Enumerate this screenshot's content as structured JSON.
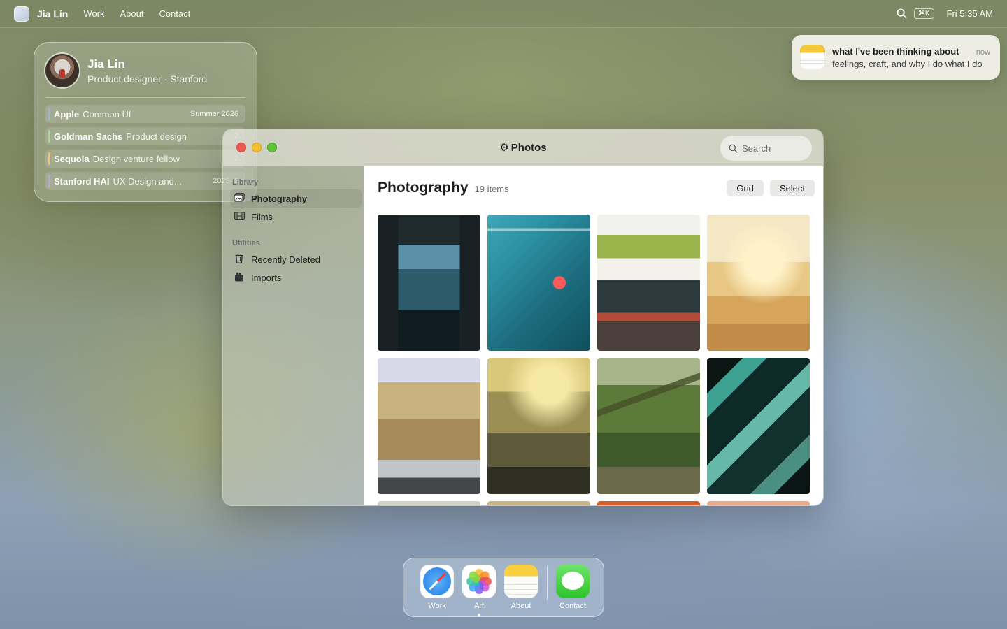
{
  "menubar": {
    "brand": "Jia Lin",
    "items": [
      "Work",
      "About",
      "Contact"
    ],
    "shortcut": "⌘K",
    "clock": "Fri 5:35 AM"
  },
  "profile": {
    "name": "Jia Lin",
    "role": "Product designer · Stanford",
    "experience": [
      {
        "company": "Apple",
        "role": "Common UI",
        "date": "Summer 2026",
        "color": "#9ab0e8"
      },
      {
        "company": "Goldman Sachs",
        "role": "Product design",
        "date": "2",
        "color": "#a8d8a0"
      },
      {
        "company": "Sequoia",
        "role": "Design venture fellow",
        "date": "2",
        "color": "#f2c46a"
      },
      {
        "company": "Stanford HAI",
        "role": "UX Design and...",
        "date": "2025–2",
        "color": "#b9a3e6"
      }
    ]
  },
  "notification": {
    "title": "what I've been thinking about",
    "time": "now",
    "text": "feelings, craft, and why I do what I do"
  },
  "window": {
    "title": "Photos",
    "search_placeholder": "Search",
    "sidebar": {
      "library_label": "Library",
      "library_items": [
        {
          "label": "Photography",
          "icon": "photo-stack-icon"
        },
        {
          "label": "Films",
          "icon": "film-icon"
        }
      ],
      "utilities_label": "Utilities",
      "utility_items": [
        {
          "label": "Recently Deleted",
          "icon": "trash-icon"
        },
        {
          "label": "Imports",
          "icon": "import-icon"
        }
      ]
    },
    "main": {
      "title": "Photography",
      "count": "19 items",
      "grid_button": "Grid",
      "select_button": "Select"
    }
  },
  "dock": [
    {
      "label": "Work",
      "icon": "safari-icon"
    },
    {
      "label": "Art",
      "icon": "photos-icon"
    },
    {
      "label": "About",
      "icon": "notes-icon"
    },
    {
      "label": "Contact",
      "icon": "messages-icon"
    }
  ]
}
